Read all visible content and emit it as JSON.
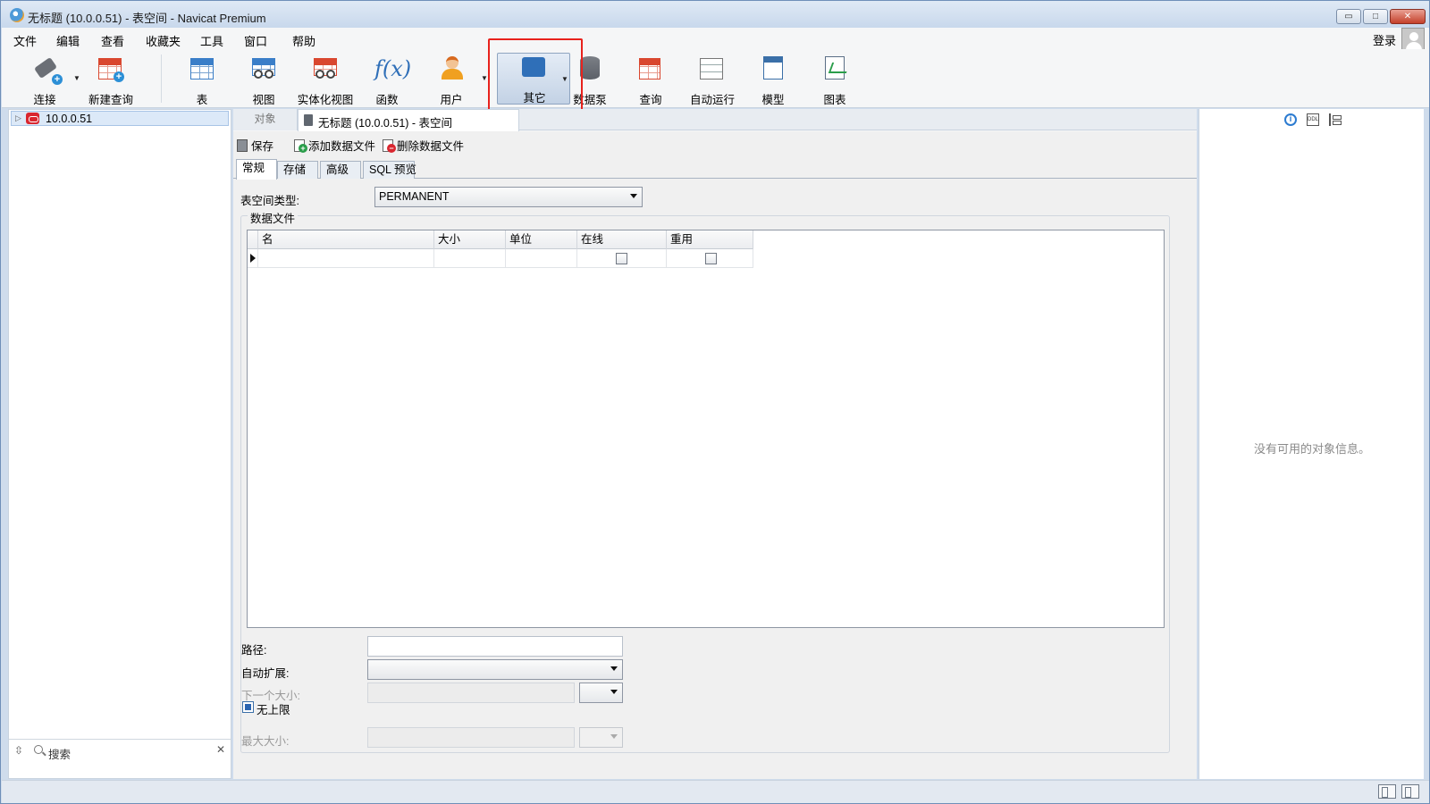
{
  "window": {
    "title": "无标题 (10.0.0.51) - 表空间 - Navicat Premium",
    "min_glyph": "▭",
    "max_glyph": "□",
    "close_glyph": "✕"
  },
  "menu": {
    "items": [
      "文件",
      "编辑",
      "查看",
      "收藏夹",
      "工具",
      "窗口",
      "帮助"
    ],
    "login": "登录"
  },
  "toolbar": {
    "items": [
      {
        "label": "连接",
        "icon": "connection-plug-icon"
      },
      {
        "label": "新建查询",
        "icon": "new-query-icon"
      },
      {
        "label": "表",
        "icon": "table-icon"
      },
      {
        "label": "视图",
        "icon": "view-icon"
      },
      {
        "label": "实体化视图",
        "icon": "materialized-view-icon"
      },
      {
        "label": "函数",
        "icon": "function-icon"
      },
      {
        "label": "用户",
        "icon": "user-icon"
      },
      {
        "label": "其它",
        "icon": "tools-icon",
        "selected": true
      },
      {
        "label": "数据泵",
        "icon": "data-pump-icon"
      },
      {
        "label": "查询",
        "icon": "query-icon"
      },
      {
        "label": "自动运行",
        "icon": "automation-icon"
      },
      {
        "label": "模型",
        "icon": "model-icon"
      },
      {
        "label": "图表",
        "icon": "chart-icon"
      }
    ],
    "function_glyph": "f(x)",
    "dropdown_glyph": "▼"
  },
  "highlight_color": "#e8221d",
  "navigator": {
    "connection": "10.0.0.51",
    "expander_glyph": "▷",
    "search_placeholder": "搜索",
    "search_toggle_glyph": "⇳",
    "clear_glyph": "✕"
  },
  "tabs": {
    "objects": "对象",
    "document": "无标题 (10.0.0.51) - 表空间"
  },
  "editor": {
    "actions": {
      "save": "保存",
      "add_datafile": "添加数据文件",
      "delete_datafile": "删除数据文件"
    },
    "subtabs": [
      "常规",
      "存储",
      "高级",
      "SQL 预览"
    ],
    "tablespace_type_label": "表空间类型:",
    "tablespace_type_value": "PERMANENT",
    "datafiles_group": "数据文件",
    "columns": [
      "名",
      "大小",
      "单位",
      "在线",
      "重用"
    ],
    "rows": [
      {
        "name": "",
        "size": "",
        "unit": "",
        "online": false,
        "reuse": false
      }
    ],
    "path_label": "路径:",
    "path_value": "",
    "autoextend_label": "自动扩展:",
    "autoextend_value": "",
    "next_size_label": "下一个大小:",
    "next_size_value": "",
    "unlimited_label": "无上限",
    "unlimited_checked": true,
    "max_size_label": "最大大小:",
    "max_size_value": ""
  },
  "info_panel": {
    "empty_text": "没有可用的对象信息。",
    "info_glyph": "i",
    "ddl_glyph": "DDL"
  }
}
